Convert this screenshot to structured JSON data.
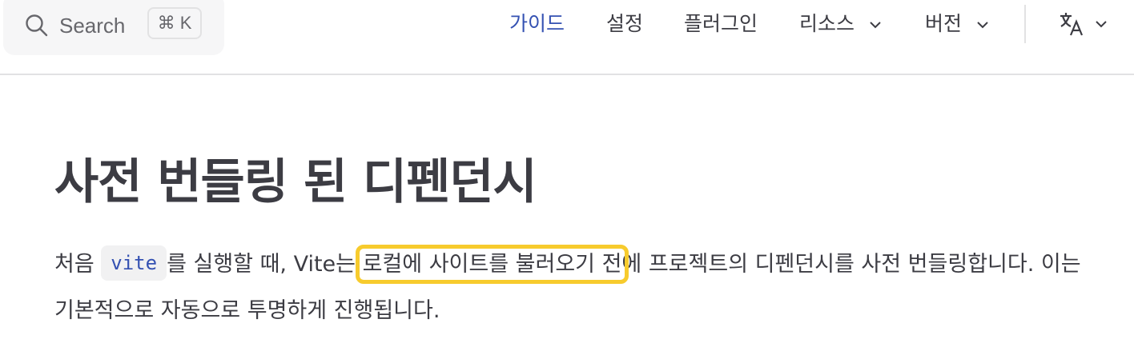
{
  "search": {
    "placeholder": "Search",
    "shortcut": "⌘ K"
  },
  "nav": {
    "items": [
      {
        "label": "가이드",
        "active": true
      },
      {
        "label": "설정"
      },
      {
        "label": "플러그인"
      },
      {
        "label": "리소스",
        "has_dropdown": true
      },
      {
        "label": "버전",
        "has_dropdown": true
      }
    ],
    "language_icon": "translate-icon"
  },
  "content": {
    "title": "사전 번들링 된 디펜던시",
    "para_1": "처음 ",
    "code": "vite",
    "para_2": "를 실행할 때, Vite는 ",
    "highlight": "로컬에 사이트를 불러오기 전",
    "para_3": "에 프로젝트의 디펜던시를 사전 번들링합니다. 이는 기본적으로 자동으로 투명하게 진행됩니다."
  },
  "colors": {
    "accent": "#3451b2",
    "highlight_box": "#f7cb2d",
    "text": "#3c3c43"
  }
}
